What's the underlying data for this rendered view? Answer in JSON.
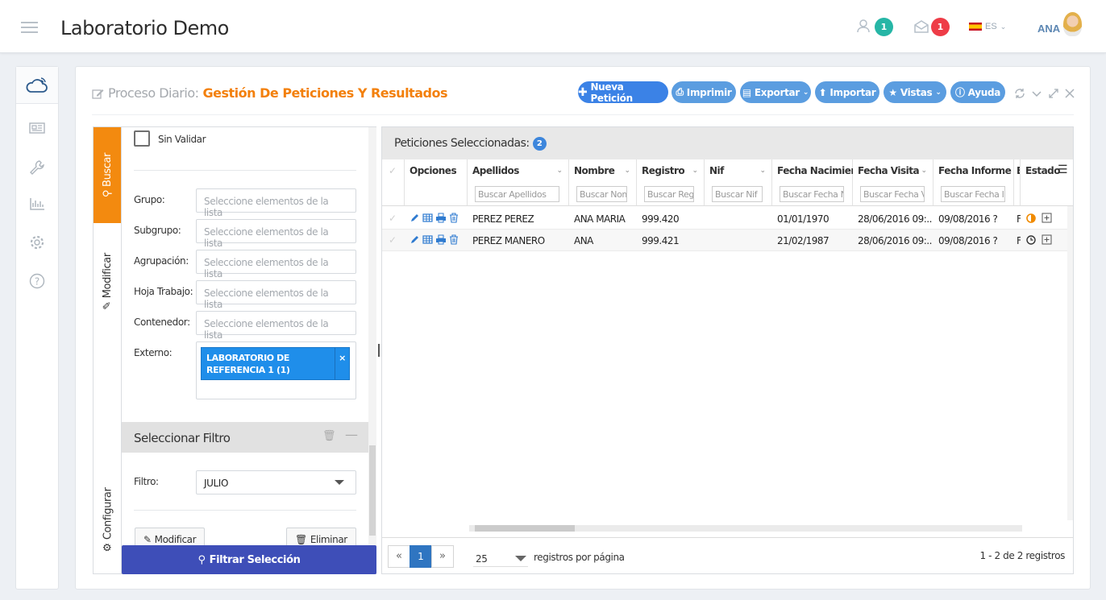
{
  "app": {
    "title": "Laboratorio Demo"
  },
  "topbar": {
    "contacts_badge": "1",
    "messages_badge": "1",
    "lang": "ES",
    "user": "ANA",
    "colors": {
      "teal": "#26b6a6",
      "red": "#ee3c47"
    }
  },
  "page": {
    "title_prefix": "Proceso Diario:",
    "title_main": "Gestión De Peticiones Y Resultados",
    "buttons": {
      "new": "Nueva Petición",
      "print": "Imprimir",
      "export": "Exportar",
      "import": "Importar",
      "views": "Vistas",
      "help": "Ayuda"
    }
  },
  "tabs": {
    "search": "Buscar",
    "modify": "Modificar",
    "configure": "Configurar"
  },
  "filters": {
    "sin_validar": "Sin Validar",
    "placeholder": "Seleccione elementos de la lista",
    "grupo": "Grupo:",
    "subgrupo": "Subgrupo:",
    "agrupacion": "Agrupación:",
    "hoja_trabajo": "Hoja Trabajo:",
    "contenedor": "Contenedor:",
    "externo": "Externo:",
    "externo_tag_line1": "LABORATORIO DE",
    "externo_tag_line2": "REFERENCIA 1 (1)",
    "tag_remove": "×",
    "select_filter_title": "Seleccionar Filtro",
    "filtro_label": "Filtro:",
    "filtro_value": "JULIO",
    "modify_btn": "Modificar",
    "delete_btn": "Eliminar",
    "apply_btn": "Filtrar Selección"
  },
  "grid": {
    "title": "Peticiones Seleccionadas:",
    "count": "2",
    "columns": {
      "opciones": "Opciones",
      "apellidos": "Apellidos",
      "nombre": "Nombre",
      "registro": "Registro",
      "nif": "Nif",
      "fecha_nac": "Fecha Nacimien...",
      "fecha_visita": "Fecha Visita",
      "fecha_informe": "Fecha Informe",
      "e": "E",
      "estado": "Estado"
    },
    "filters": {
      "apellidos": "Buscar Apellidos",
      "nombre": "Buscar Nom",
      "registro": "Buscar Reg",
      "nif": "Buscar Nif",
      "fecha_nac": "Buscar Fecha N",
      "fecha_visita": "Buscar Fecha V",
      "fecha_informe": "Buscar Fecha I"
    },
    "rows": [
      {
        "apellidos": "PEREZ PEREZ",
        "nombre": "ANA MARIA",
        "registro": "999.420",
        "nif": "",
        "fecha_nac": "01/01/1970",
        "fecha_visita": "28/06/2016 09:...",
        "fecha_informe": "09/08/2016 ?",
        "e": "F",
        "estado": "partial-icon"
      },
      {
        "apellidos": "PEREZ MANERO",
        "nombre": "ANA",
        "registro": "999.421",
        "nif": "",
        "fecha_nac": "21/02/1987",
        "fecha_visita": "28/06/2016 09:...",
        "fecha_informe": "09/08/2016 ?",
        "e": "F",
        "estado": "clock-icon"
      }
    ],
    "pager": {
      "page": "1",
      "page_size": "25",
      "per_page_label": "registros por página",
      "summary": "1 - 2 de 2 registros"
    }
  }
}
